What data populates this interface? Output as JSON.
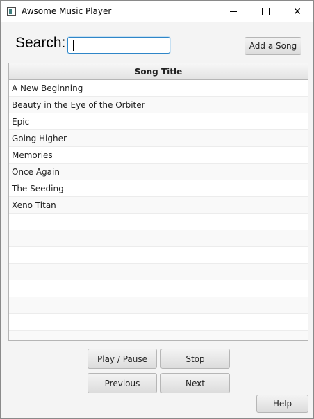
{
  "window": {
    "title": "Awsome Music Player",
    "icon": "app-window-icon",
    "controls": {
      "minimize_icon": "minimize-icon",
      "maximize_icon": "maximize-icon",
      "close_icon": "close-icon",
      "close_glyph": "✕"
    }
  },
  "search": {
    "label": "Search:",
    "value": "",
    "placeholder": ""
  },
  "toolbar": {
    "add_song_label": "Add a Song"
  },
  "table": {
    "column_header": "Song Title",
    "rows": [
      "A New Beginning",
      "Beauty in the Eye of the Orbiter",
      "Epic",
      "Going Higher",
      "Memories",
      "Once Again",
      "The Seeding",
      "Xeno Titan"
    ]
  },
  "controls": {
    "play_pause_label": "Play / Pause",
    "stop_label": "Stop",
    "previous_label": "Previous",
    "next_label": "Next",
    "help_label": "Help"
  },
  "colors": {
    "focus_border": "#2f86c8",
    "window_background": "#f4f4f4",
    "alt_row": "#f9f9f9"
  }
}
